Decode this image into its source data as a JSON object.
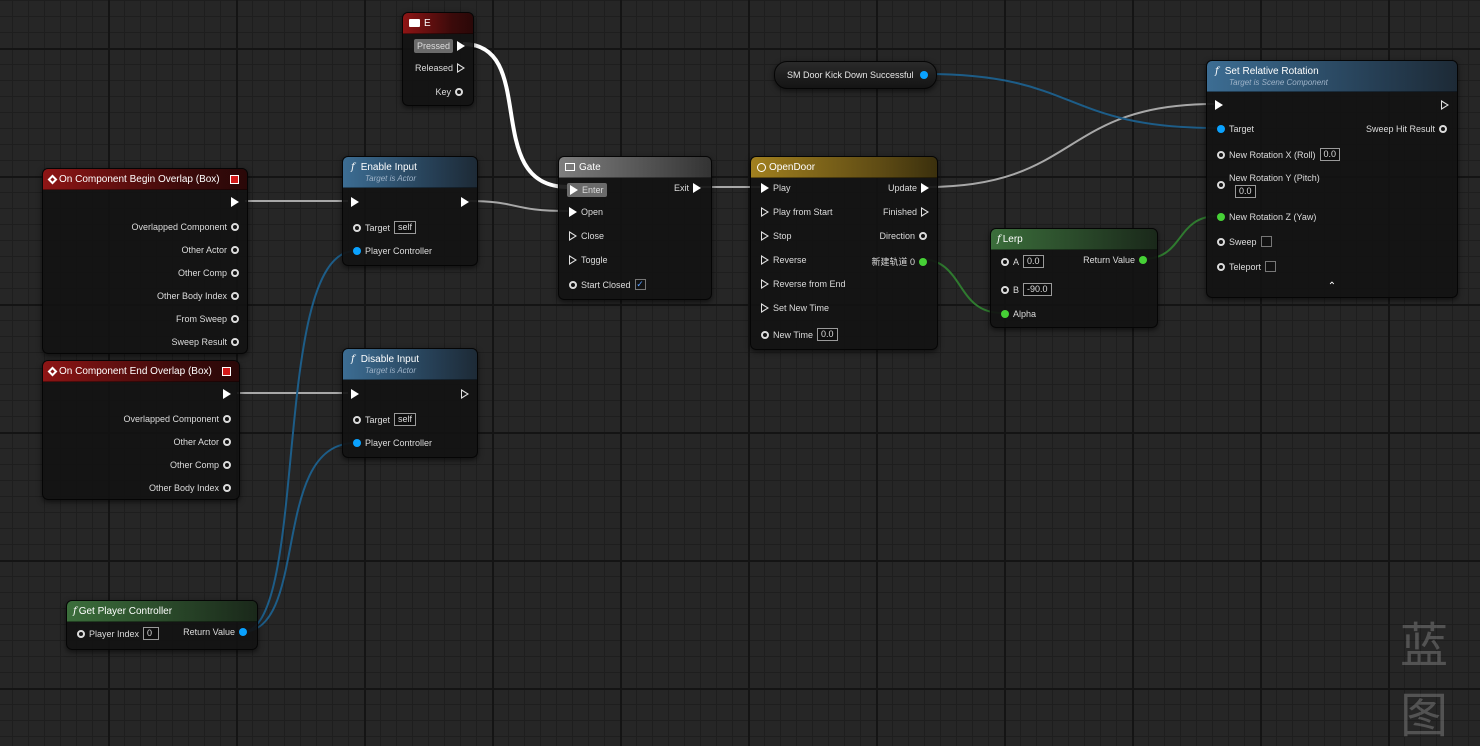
{
  "key_event": {
    "title": "E",
    "pins": {
      "pressed": "Pressed",
      "released": "Released",
      "key": "Key"
    }
  },
  "begin_overlap": {
    "title": "On Component Begin Overlap (Box)",
    "pins": [
      "Overlapped Component",
      "Other Actor",
      "Other Comp",
      "Other Body Index",
      "From Sweep",
      "Sweep Result"
    ]
  },
  "end_overlap": {
    "title": "On Component End Overlap (Box)",
    "pins": [
      "Overlapped Component",
      "Other Actor",
      "Other Comp",
      "Other Body Index"
    ]
  },
  "enable_input": {
    "title": "Enable Input",
    "subtitle": "Target is Actor",
    "target_label": "Target",
    "target_value": "self",
    "pc_label": "Player Controller"
  },
  "disable_input": {
    "title": "Disable Input",
    "subtitle": "Target is Actor",
    "target_label": "Target",
    "target_value": "self",
    "pc_label": "Player Controller"
  },
  "gate": {
    "title": "Gate",
    "enter": "Enter",
    "exit": "Exit",
    "open": "Open",
    "close": "Close",
    "toggle": "Toggle",
    "start_closed": "Start Closed",
    "start_closed_mark": "✓"
  },
  "timeline": {
    "title": "OpenDoor",
    "inputs": [
      "Play",
      "Play from Start",
      "Stop",
      "Reverse",
      "Reverse from End",
      "Set New Time"
    ],
    "new_time_label": "New Time",
    "new_time_value": "0.0",
    "outputs": {
      "update": "Update",
      "finished": "Finished",
      "direction": "Direction",
      "track": "新建轨道 0"
    }
  },
  "variable": {
    "name": "SM Door Kick Down Successful"
  },
  "lerp": {
    "title": "Lerp",
    "a_label": "A",
    "a_value": "0.0",
    "b_label": "B",
    "b_value": "-90.0",
    "alpha_label": "Alpha",
    "return_label": "Return Value"
  },
  "set_rotation": {
    "title": "Set Relative Rotation",
    "subtitle": "Target is Scene Component",
    "target_label": "Target",
    "sweep_hit": "Sweep Hit Result",
    "rot_x_label": "New Rotation X (Roll)",
    "rot_x_value": "0.0",
    "rot_y_label": "New Rotation Y (Pitch)",
    "rot_y_value": "0.0",
    "rot_z_label": "New Rotation Z (Yaw)",
    "sweep_label": "Sweep",
    "teleport_label": "Teleport",
    "collapse_glyph": "⌃"
  },
  "get_pc": {
    "title": "Get Player Controller",
    "index_label": "Player Index",
    "index_value": "0",
    "return_label": "Return Value"
  },
  "watermark": "蓝图",
  "colors": {
    "object_pin": "#0aa2ff",
    "struct_pin": "#14cdb0",
    "float_pin": "#46d136",
    "bool_pin": "#a40f0f",
    "event_header": "#8e1515",
    "function_header": "#3c6d93",
    "pure_header": "#3b6e3b",
    "timeline_header": "#a1801f"
  }
}
